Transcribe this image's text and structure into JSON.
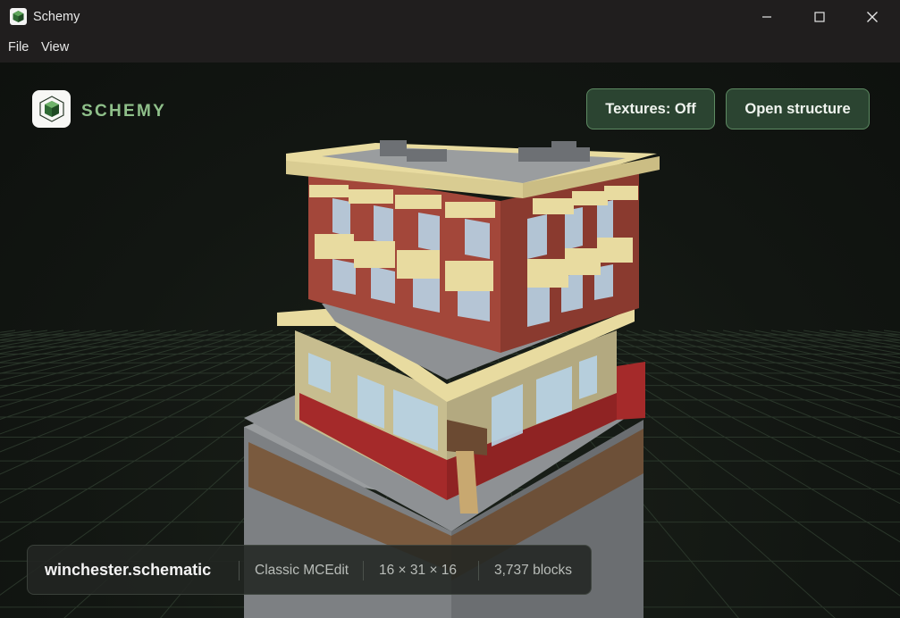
{
  "window": {
    "title": "Schemy"
  },
  "menu": [
    {
      "label": "File"
    },
    {
      "label": "View"
    }
  ],
  "brand": {
    "name": "SCHEMY"
  },
  "toolbar": {
    "textures_label": "Textures: Off",
    "open_label": "Open structure"
  },
  "info": {
    "filename": "winchester.schematic",
    "format": "Classic MCEdit",
    "dimensions": "16 × 31 × 16",
    "block_count": "3,737 blocks"
  },
  "colors": {
    "accent": "#8fc08a",
    "button_bg": "#2b4431",
    "button_border": "#5d8a62",
    "titlebar": "#201e1e",
    "viewport_bg": "#121612"
  },
  "icons": [
    "app-cube-icon",
    "minimize-icon",
    "maximize-icon",
    "close-icon",
    "logo-cube-icon"
  ]
}
